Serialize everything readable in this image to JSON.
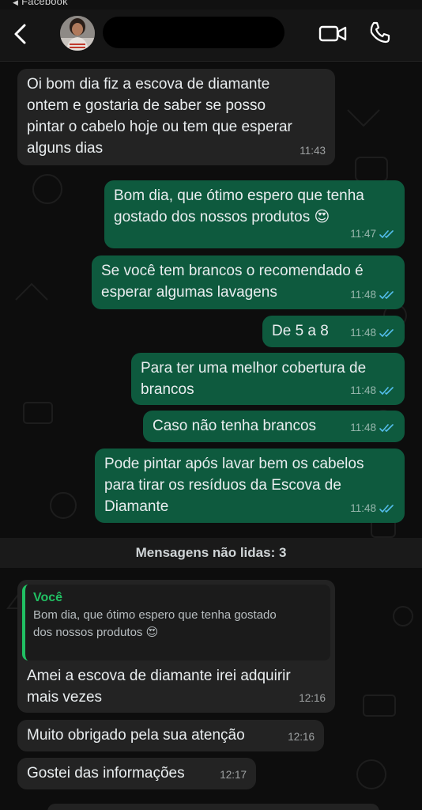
{
  "status_bar": {
    "back_app": "Facebook"
  },
  "header": {
    "back_icon": "chevron-left-icon",
    "video_icon": "video-camera-icon",
    "call_icon": "phone-icon"
  },
  "messages": [
    {
      "dir": "in",
      "text": "Oi bom dia fiz a escova de diamante\nontem e gostaria de saber se posso\npintar o cabelo hoje ou tem que esperar\nalguns dias",
      "time": "11:43"
    },
    {
      "dir": "out",
      "text": "Bom dia, que ótimo espero que tenha\ngostado dos nossos produtos 😍",
      "time": "11:47"
    },
    {
      "dir": "out",
      "text": "Se você tem brancos o recomendado é\nesperar algumas lavagens",
      "time": "11:48"
    },
    {
      "dir": "out",
      "text": "De 5 a 8",
      "time": "11:48"
    },
    {
      "dir": "out",
      "text": "Para ter uma melhor cobertura de\nbrancos",
      "time": "11:48"
    },
    {
      "dir": "out",
      "text": "Caso não tenha brancos",
      "time": "11:48"
    },
    {
      "dir": "out",
      "text": "Pode pintar após lavar bem os cabelos\npara tirar os resíduos da Escova de\nDiamante",
      "time": "11:48"
    }
  ],
  "unread_label": "Mensagens não lidas: 3",
  "reply_message": {
    "quote_author": "Você",
    "quote_text": "Bom dia, que ótimo espero que tenha gostado\ndos nossos produtos 😍",
    "text": "Amei a escova de diamante  irei adquirir\nmais vezes",
    "time": "12:16"
  },
  "incoming_after": [
    {
      "text": "Muito obrigado pela sua atenção",
      "time": "12:16"
    },
    {
      "text": "Gostei das informações",
      "time": "12:17"
    }
  ],
  "colors": {
    "outgoing_bubble": "#0e5a3e",
    "incoming_bubble": "#232323",
    "read_ticks": "#53bdeb",
    "quote_accent": "#21c063"
  }
}
